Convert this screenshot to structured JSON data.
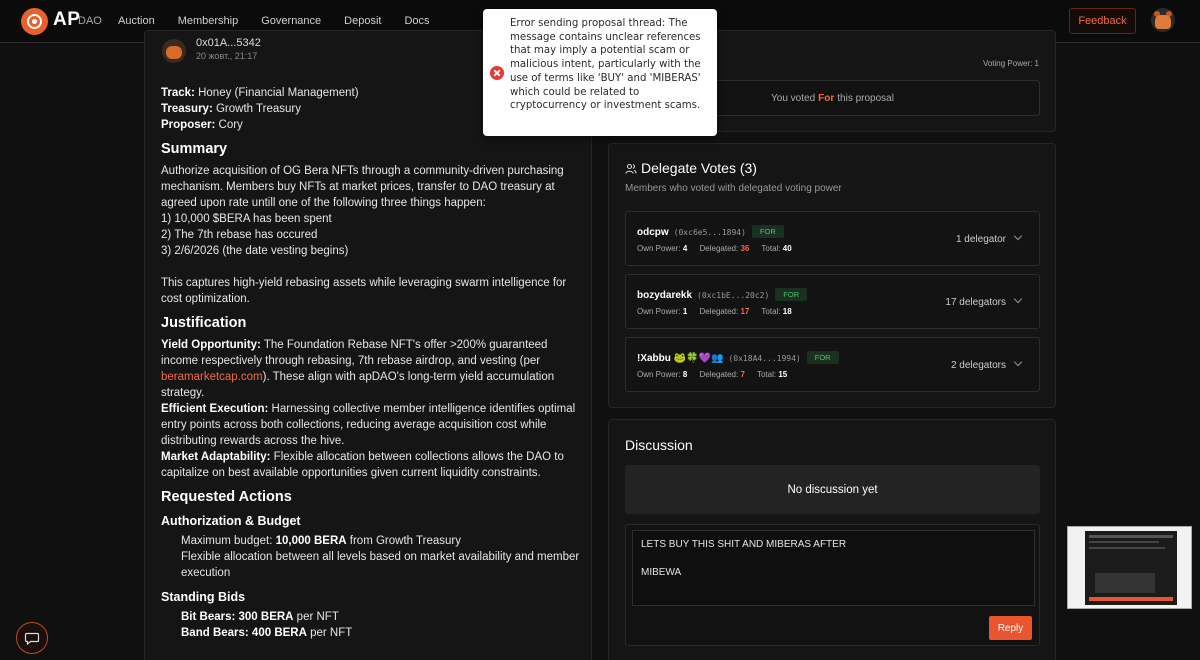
{
  "brand": {
    "name": "AP",
    "sub": "DAO",
    "accent": "#e8612c"
  },
  "nav": {
    "items": [
      "Auction",
      "Membership",
      "Governance",
      "Deposit",
      "Docs"
    ]
  },
  "header": {
    "feedback_label": "Feedback"
  },
  "toast": {
    "type": "error",
    "icon": "error-circle-icon",
    "message": "Error sending proposal thread: The message contains unclear references that may imply a potential scam or malicious intent, particularly with the use of terms like 'BUY' and 'MIBERAS' which could be related to cryptocurrency or investment scams."
  },
  "proposal": {
    "author_address": "0x01A...5342",
    "author_date": "20 жовт., 21:17",
    "track_label": "Track:",
    "track_value": "Honey (Financial Management)",
    "treasury_label": "Treasury:",
    "treasury_value": "Growth Treasury",
    "proposer_label": "Proposer:",
    "proposer_value": "Cory",
    "summary_heading": "Summary",
    "summary_p1": "Authorize acquisition of OG Bera NFTs through a community-driven purchasing mechanism. Members buy NFTs at market prices, transfer to DAO treasury at agreed upon rate untill one of the following three things happen:",
    "summary_l1": "1) 10,000 $BERA has been spent",
    "summary_l2": "2) The 7th rebase has occured",
    "summary_l3": "3) 2/6/2026 (the date vesting begins)",
    "summary_p2": "This captures high-yield rebasing assets while leveraging swarm intelligence for cost optimization.",
    "justification_heading": "Justification",
    "yield_label": "Yield Opportunity:",
    "yield_text": " The Foundation Rebase NFT's  offer >200% guaranteed income respectively through rebasing, 7th rebase airdrop, and vesting (per ",
    "yield_link": "beramarketcap.com",
    "yield_text2": "). These align with apDAO's long-term yield accumulation strategy.",
    "efficient_label": "Efficient Execution:",
    "efficient_text": " Harnessing collective member intelligence identifies optimal entry points across both collections, reducing average acquisition cost while distributing rewards across the hive.",
    "market_label": "Market Adaptability:",
    "market_text": " Flexible allocation between collections allows the DAO to capitalize on best available opportunities given current liquidity constraints.",
    "requested_heading": "Requested Actions",
    "auth_heading": "Authorization & Budget",
    "budget_prefix": "Maximum budget: ",
    "budget_value": "10,000 BERA",
    "budget_suffix": " from Growth Treasury",
    "flex_text": "Flexible allocation between all levels based on market availability and member execution",
    "bids_heading": "Standing Bids",
    "bid1_label": "Bit Bears: 300 BERA",
    "bid1_suffix": " per NFT",
    "bid2_label": "Band Bears:  400 BERA",
    "bid2_suffix": " per NFT"
  },
  "vote": {
    "voting_power": "Voting Power: 1",
    "voted_prefix": "You voted",
    "voted_choice": "For",
    "voted_suffix": "this proposal"
  },
  "delegates": {
    "title": "Delegate Votes (3)",
    "subtitle": "Members who voted with delegated voting power",
    "items": [
      {
        "name": "odcpw",
        "address": "(0xc6e5...1894)",
        "vote": "FOR",
        "own_label": "Own Power:",
        "own": "4",
        "delegated_label": "Delegated:",
        "delegated": "36",
        "total_label": "Total:",
        "total": "40",
        "count": "1 delegator"
      },
      {
        "name": "bozydarekk",
        "address": "(0xc1bE...20c2)",
        "vote": "FOR",
        "own_label": "Own Power:",
        "own": "1",
        "delegated_label": "Delegated:",
        "delegated": "17",
        "total_label": "Total:",
        "total": "18",
        "count": "17 delegators"
      },
      {
        "name": "!Xabbu 🐸🍀💜👥",
        "address": "(0x18A4...1994)",
        "vote": "FOR",
        "own_label": "Own Power:",
        "own": "8",
        "delegated_label": "Delegated:",
        "delegated": "7",
        "total_label": "Total:",
        "total": "15",
        "count": "2 delegators"
      }
    ]
  },
  "discussion": {
    "title": "Discussion",
    "empty_text": "No discussion yet",
    "reply_value": "LETS BUY THIS SHIT AND MIBERAS AFTER\n\nMIBEWA",
    "reply_label": "Reply"
  }
}
